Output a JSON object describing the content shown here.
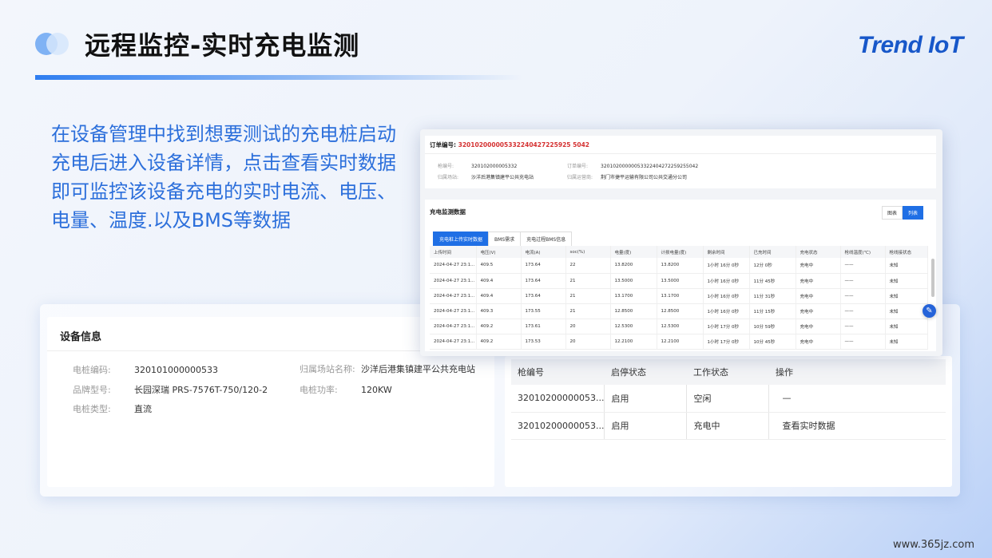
{
  "title": "远程监控-实时充电监测",
  "brand": "Trend IoT",
  "description": "在设备管理中找到想要测试的充电桩启动充电后进入设备详情，点击查看实时数据即可监控该设备充电的实时电流、电压、电量、温度.以及BMS等数据",
  "device_info": {
    "title": "设备信息",
    "items": [
      {
        "label": "电桩编码:",
        "value": "320101000000533"
      },
      {
        "label": "归属场站名称:",
        "value": "沙洋后港集镇建平公共充电站"
      },
      {
        "label": "品牌型号:",
        "value": "长园深瑞 PRS-7576T-750/120-2"
      },
      {
        "label": "电桩功率:",
        "value": "120KW"
      },
      {
        "label": "电桩类型:",
        "value": "直流"
      }
    ]
  },
  "gun_table": {
    "headers": [
      "枪编号",
      "启停状态",
      "工作状态",
      "操作"
    ],
    "rows": [
      {
        "id": "32010200000053...",
        "switch": "启用",
        "work": "空闲",
        "op": "—"
      },
      {
        "id": "32010200000053...",
        "switch": "启用",
        "work": "充电中",
        "op": "查看实时数据"
      }
    ]
  },
  "order": {
    "label": "订单编号:",
    "number": "320102000005332240427225925 5042",
    "items": [
      {
        "label": "枪编号:",
        "value": "320102000005332"
      },
      {
        "label": "订单编号:",
        "value": "32010200000053322404272259255042"
      },
      {
        "label": "归属场站:",
        "value": "沙洋后港集镇建平公共充电站"
      },
      {
        "label": "归属运营商:",
        "value": "荆门市捷平运输有限公司公共交通分公司"
      }
    ]
  },
  "monitor": {
    "title": "充电监测数据",
    "view_buttons": [
      "图表",
      "列表"
    ],
    "tabs": [
      "充电桩上传实时数据",
      "BMS需求",
      "充电过程BMS信息"
    ],
    "headers": [
      "上传时间",
      "电压(V)",
      "电流(A)",
      "soc(%)",
      "电量(度)",
      "计损电量(度)",
      "剩余时间",
      "已充时间",
      "充电状态",
      "枪线温度(℃)",
      "枪线接状态"
    ],
    "rows": [
      [
        "2024-04-27 23:1...",
        "409.5",
        "173.64",
        "22",
        "13.8200",
        "13.8200",
        "1小时 16分 0秒",
        "12分 0秒",
        "充电中",
        "——",
        "未知"
      ],
      [
        "2024-04-27 23:1...",
        "409.4",
        "173.64",
        "21",
        "13.5000",
        "13.5000",
        "1小时 16分 0秒",
        "11分 45秒",
        "充电中",
        "——",
        "未知"
      ],
      [
        "2024-04-27 23:1...",
        "409.4",
        "173.64",
        "21",
        "13.1700",
        "13.1700",
        "1小时 16分 0秒",
        "11分 31秒",
        "充电中",
        "——",
        "未知"
      ],
      [
        "2024-04-27 23:1...",
        "409.3",
        "173.55",
        "21",
        "12.8500",
        "12.8500",
        "1小时 16分 0秒",
        "11分 15秒",
        "充电中",
        "——",
        "未知"
      ],
      [
        "2024-04-27 23:1...",
        "409.2",
        "173.61",
        "20",
        "12.5300",
        "12.5300",
        "1小时 17分 0秒",
        "10分 59秒",
        "充电中",
        "——",
        "未知"
      ],
      [
        "2024-04-27 23:1...",
        "409.2",
        "173.53",
        "20",
        "12.2100",
        "12.2100",
        "1小时 17分 0秒",
        "10分 45秒",
        "充电中",
        "——",
        "未知"
      ]
    ]
  },
  "watermark": "www.365jz.com"
}
